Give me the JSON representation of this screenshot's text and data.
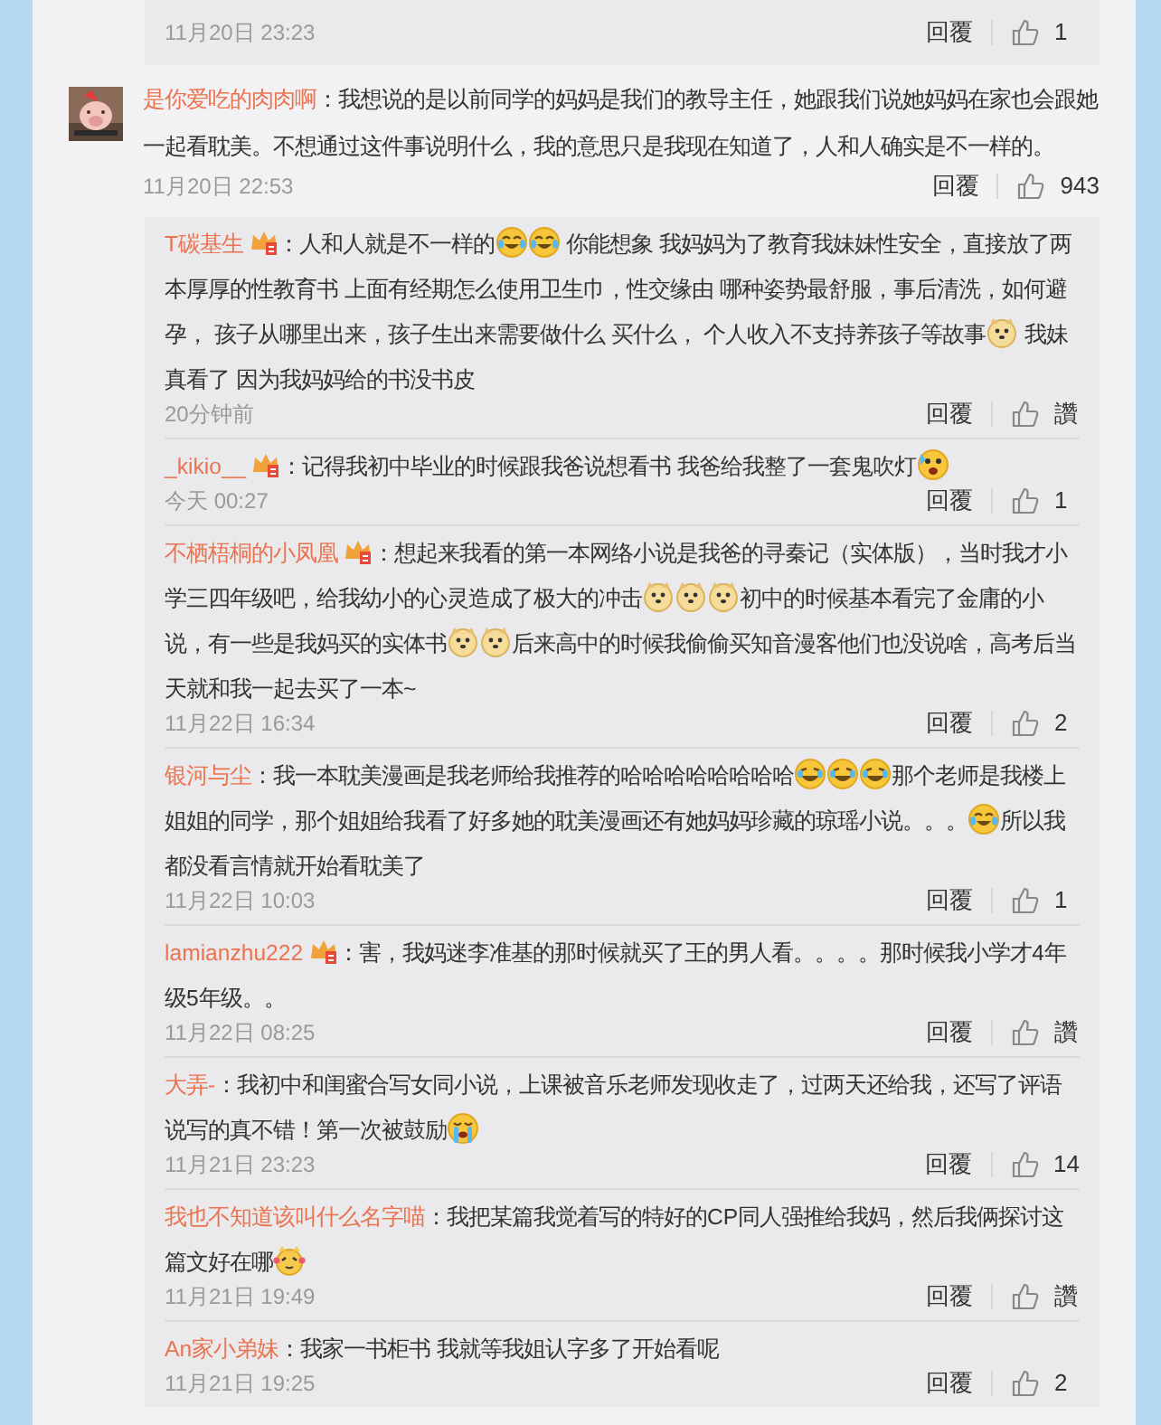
{
  "previous_reply_footer": {
    "time": "11月20日 23:23",
    "reply": "回覆",
    "likes": "1"
  },
  "comment": {
    "user": "是你爱吃的肉肉啊",
    "content": [
      {
        "kind": "text",
        "text": "：我想说的是以前同学的妈妈是我们的教导主任，她跟我们说她妈妈在家也会跟她一起看耽美。不想通过这件事说明什么，我的意思只是我现在知道了，人和人确实是不一样的。"
      }
    ],
    "time": "11月20日 22:53",
    "reply": "回覆",
    "likes": "943"
  },
  "replies": [
    {
      "user": "T碳基生",
      "vip_badge": true,
      "content": [
        {
          "kind": "text",
          "text": "：人和人就是不一样的"
        },
        {
          "kind": "tears-of-joy"
        },
        {
          "kind": "tears-of-joy"
        },
        {
          "kind": "text",
          "text": " 你能想象 我妈妈为了教育我妹妹性安全，直接放了两本厚厚的性教育书 上面有经期怎么使用卫生巾，性交缘由 哪种姿势最舒服，事后清洗，如何避孕， 孩子从哪里出来，孩子生出来需要做什么 买什么， 个人收入不支持养孩子等故事"
        },
        {
          "kind": "doge"
        },
        {
          "kind": "text",
          "text": " 我妹真看了 因为我妈妈给的书没书皮"
        }
      ],
      "time": "20分钟前",
      "reply": "回覆",
      "likes": "讚"
    },
    {
      "user": "_kikio__",
      "vip_badge": true,
      "content": [
        {
          "kind": "text",
          "text": "：记得我初中毕业的时候跟我爸说想看书 我爸给我整了一套鬼吹灯"
        },
        {
          "kind": "scared"
        }
      ],
      "time": "今天 00:27",
      "reply": "回覆",
      "likes": "1"
    },
    {
      "user": "不栖梧桐的小凤凰",
      "vip_badge": true,
      "content": [
        {
          "kind": "text",
          "text": "：想起来我看的第一本网络小说是我爸的寻秦记（实体版），当时我才小学三四年级吧，给我幼小的心灵造成了极大的冲击"
        },
        {
          "kind": "doge"
        },
        {
          "kind": "doge"
        },
        {
          "kind": "doge"
        },
        {
          "kind": "text",
          "text": "初中的时候基本看完了金庸的小说，有一些是我妈买的实体书"
        },
        {
          "kind": "doge"
        },
        {
          "kind": "doge"
        },
        {
          "kind": "text",
          "text": "后来高中的时候我偷偷买知音漫客他们也没说啥，高考后当天就和我一起去买了一本~"
        }
      ],
      "time": "11月22日 16:34",
      "reply": "回覆",
      "likes": "2"
    },
    {
      "user": "银河与尘",
      "vip_badge": false,
      "content": [
        {
          "kind": "text",
          "text": "：我一本耽美漫画是我老师给我推荐的哈哈哈哈哈哈哈哈"
        },
        {
          "kind": "laughing"
        },
        {
          "kind": "laughing"
        },
        {
          "kind": "laughing"
        },
        {
          "kind": "text",
          "text": "那个老师是我楼上姐姐的同学，那个姐姐给我看了好多她的耽美漫画还有她妈妈珍藏的琼瑶小说。。。"
        },
        {
          "kind": "tears-of-joy"
        },
        {
          "kind": "text",
          "text": "所以我都没看言情就开始看耽美了"
        }
      ],
      "time": "11月22日 10:03",
      "reply": "回覆",
      "likes": "1"
    },
    {
      "user": "lamianzhu222",
      "vip_badge": true,
      "content": [
        {
          "kind": "text",
          "text": "：害，我妈迷李准基的那时候就买了王的男人看。。。。那时候我小学才4年级5年级。。"
        }
      ],
      "time": "11月22日 08:25",
      "reply": "回覆",
      "likes": "讚"
    },
    {
      "user": "大弄-",
      "vip_badge": false,
      "content": [
        {
          "kind": "text",
          "text": "：我初中和闺蜜合写女同小说，上课被音乐老师发现收走了，过两天还给我，还写了评语说写的真不错！第一次被鼓励"
        },
        {
          "kind": "crying"
        }
      ],
      "time": "11月21日 23:23",
      "reply": "回覆",
      "likes": "14"
    },
    {
      "user": "我也不知道该叫什么名字喵",
      "vip_badge": false,
      "content": [
        {
          "kind": "text",
          "text": "：我把某篇我觉着写的特好的CP同人强推给我妈，然后我俩探讨这篇文好在哪"
        },
        {
          "kind": "smitten"
        }
      ],
      "time": "11月21日 19:49",
      "reply": "回覆",
      "likes": "讚"
    },
    {
      "user": "An家小弟妹",
      "vip_badge": false,
      "content": [
        {
          "kind": "text",
          "text": "：我家一书柜书 我就等我姐认字多了开始看呢"
        }
      ],
      "time": "11月21日 19:25",
      "reply": "回覆",
      "likes": "2"
    }
  ]
}
